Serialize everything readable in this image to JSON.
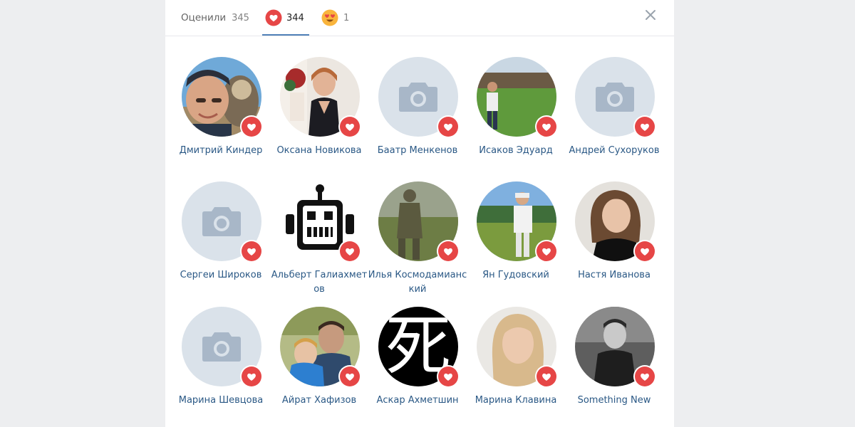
{
  "tabs": [
    {
      "label": "Оценили",
      "count": "345"
    },
    {
      "label": "",
      "count": "344",
      "icon": "heart-reaction-icon"
    },
    {
      "label": "",
      "count": "1",
      "icon": "heart-eyes-reaction-icon"
    }
  ],
  "users": [
    {
      "name": "Дмитрий Киндер",
      "avatar": "photo"
    },
    {
      "name": "Оксана Новикова",
      "avatar": "photo"
    },
    {
      "name": "Баатр Менкенов",
      "avatar": "camera-placeholder"
    },
    {
      "name": "Исаков Эдуард",
      "avatar": "photo"
    },
    {
      "name": "Андрей Сухоруков",
      "avatar": "camera-placeholder"
    },
    {
      "name": "Сергеи Широков",
      "avatar": "camera-placeholder"
    },
    {
      "name": "Альберт Галиахметов",
      "avatar": "robot"
    },
    {
      "name": "Илья Космодамианский",
      "avatar": "photo"
    },
    {
      "name": "Ян Гудовский",
      "avatar": "photo"
    },
    {
      "name": "Настя Иванова",
      "avatar": "photo"
    },
    {
      "name": "Марина Шевцова",
      "avatar": "camera-placeholder"
    },
    {
      "name": "Айрат Хафизов",
      "avatar": "photo"
    },
    {
      "name": "Аскар Ахметшин",
      "avatar": "kanji",
      "avatar_text": "死"
    },
    {
      "name": "Марина Клавина",
      "avatar": "photo"
    },
    {
      "name": "Something New",
      "avatar": "photo"
    }
  ],
  "colors": {
    "accent": "#5181b8",
    "link": "#2a5885",
    "heart": "#e64646",
    "placeholder_bg": "#dae2ea",
    "placeholder_icon": "#a8b7c8"
  }
}
